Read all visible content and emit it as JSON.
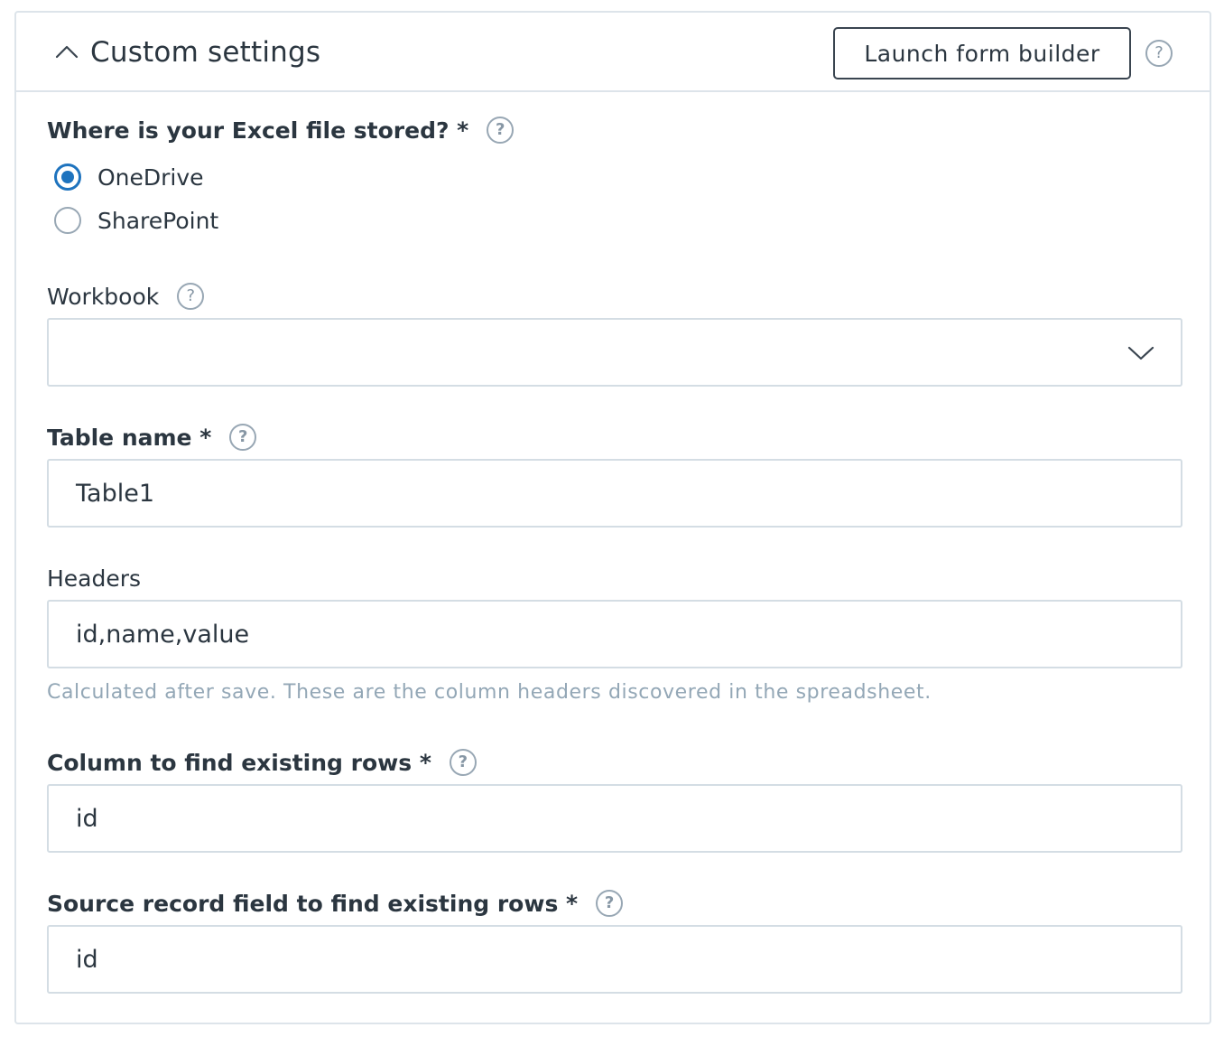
{
  "header": {
    "title": "Custom settings",
    "launch_button_label": "Launch form builder",
    "help_icon_glyph": "?"
  },
  "storage": {
    "label": "Where is your Excel file stored? *",
    "help_icon_glyph": "?",
    "options": [
      {
        "label": "OneDrive",
        "selected": true
      },
      {
        "label": "SharePoint",
        "selected": false
      }
    ]
  },
  "workbook": {
    "label": "Workbook",
    "help_icon_glyph": "?",
    "value": ""
  },
  "table_name": {
    "label": "Table name *",
    "help_icon_glyph": "?",
    "value": "Table1"
  },
  "headers": {
    "label": "Headers",
    "value": "id,name,value",
    "hint": "Calculated after save. These are the column headers discovered in the spreadsheet."
  },
  "column_find": {
    "label": "Column to find existing rows *",
    "help_icon_glyph": "?",
    "value": "id"
  },
  "source_field": {
    "label": "Source record field to find existing rows *",
    "help_icon_glyph": "?",
    "value": "id"
  },
  "colors": {
    "accent": "#1e73be",
    "border": "#dde4ea",
    "hint": "#93a7b6",
    "text": "#2b3640"
  }
}
